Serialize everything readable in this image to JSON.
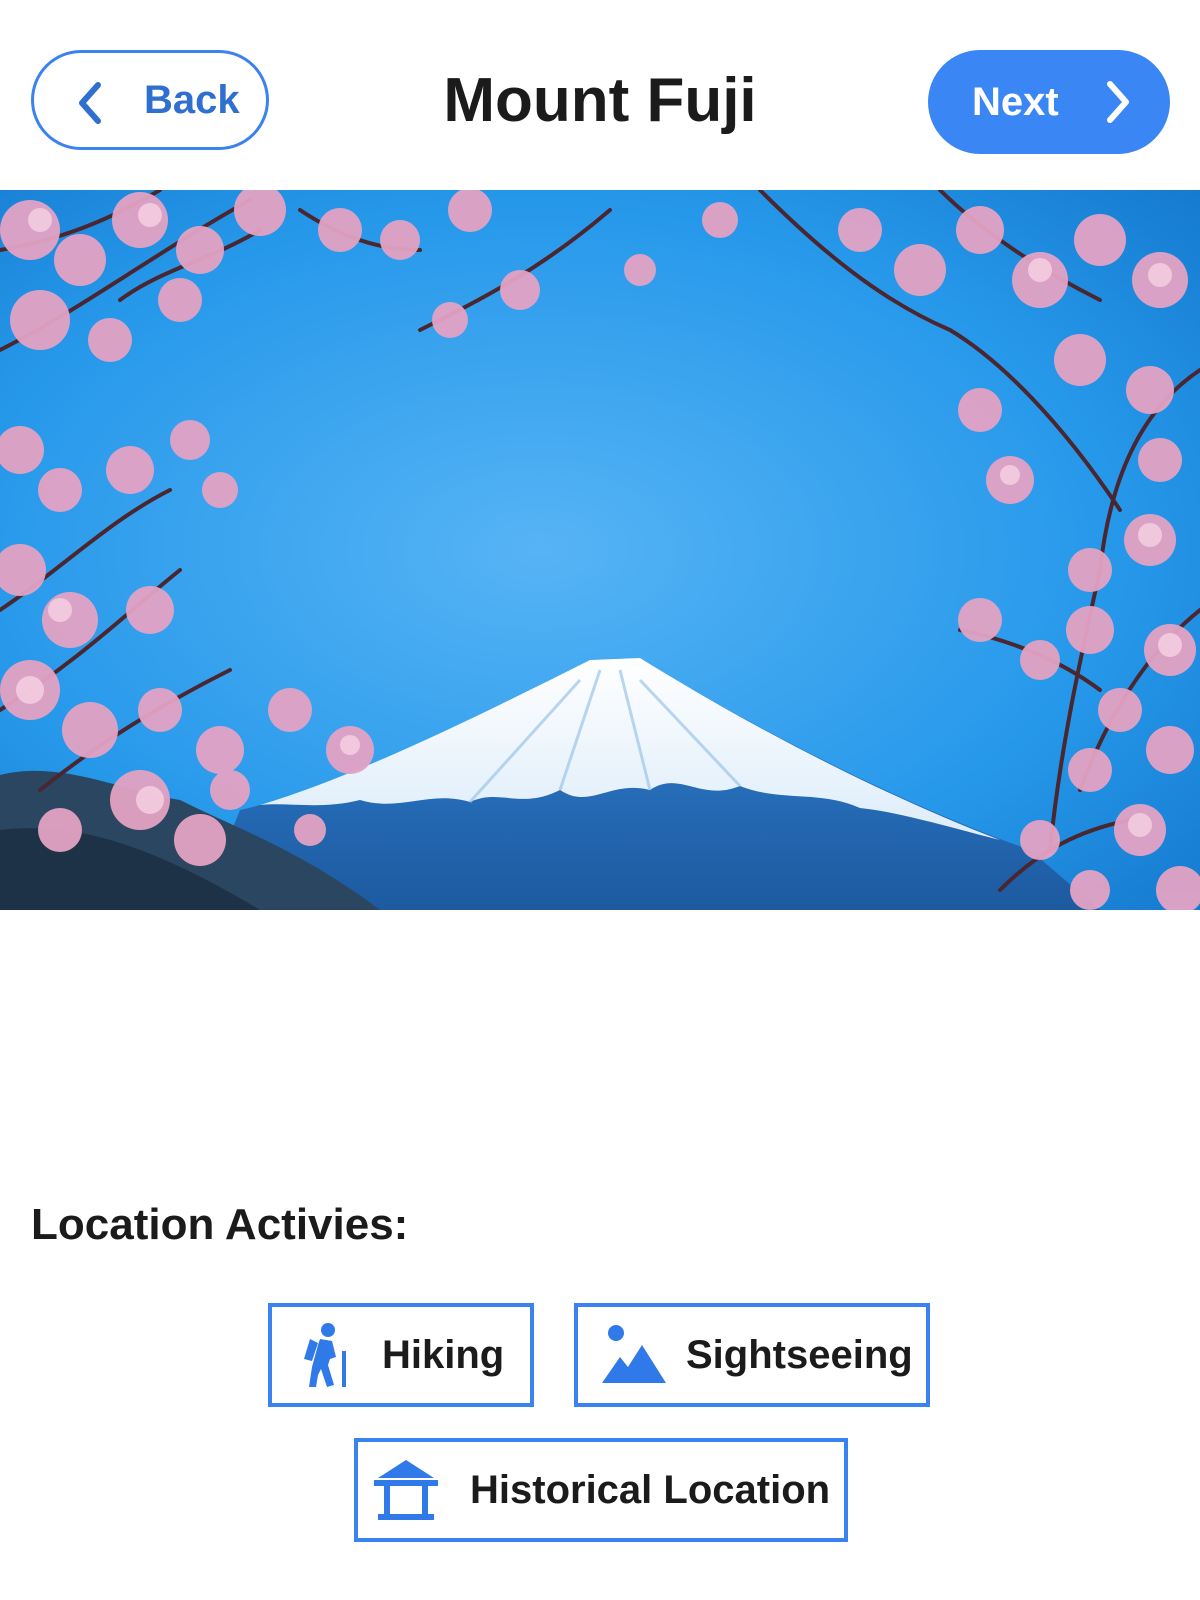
{
  "header": {
    "back_label": "Back",
    "title": "Mount Fuji",
    "next_label": "Next"
  },
  "hero": {
    "subject": "mountain-with-cherry-blossoms-photo"
  },
  "activities": {
    "heading": "Location Activies:",
    "items": [
      {
        "label": "Hiking",
        "icon": "hiking-icon"
      },
      {
        "label": "Sightseeing",
        "icon": "landscape-icon"
      },
      {
        "label": "Historical Location",
        "icon": "temple-icon"
      }
    ]
  },
  "colors": {
    "accent": "#3a86f5",
    "accent_border": "#3a82f0",
    "back_text": "#2f6fcf",
    "sky": "#1e8fe0",
    "blossom": "#e3a3c4"
  }
}
